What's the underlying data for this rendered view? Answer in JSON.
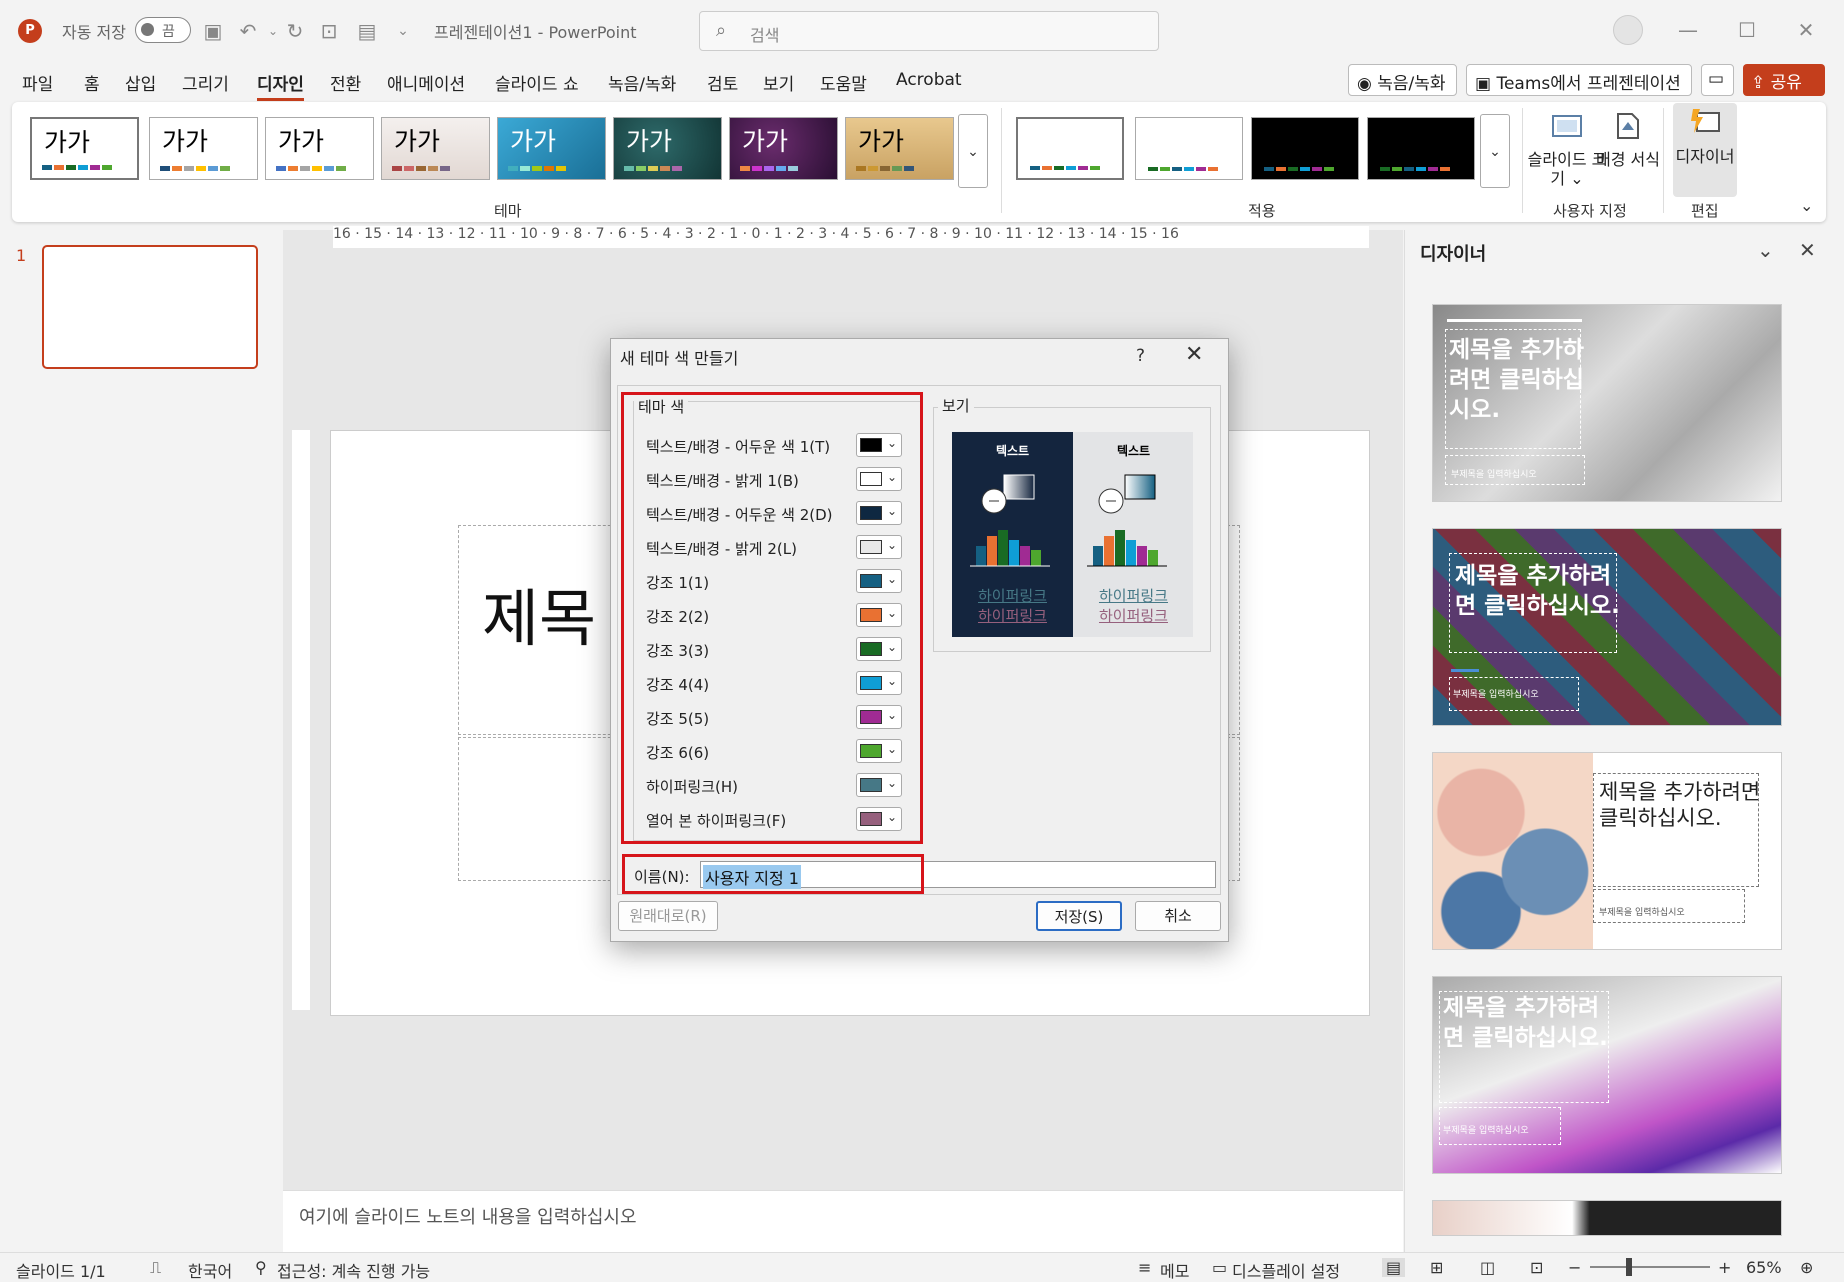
{
  "titlebar": {
    "autosave_label": "자동 저장",
    "autosave_state": "끔",
    "doc_title": "프레젠테이션1  -  PowerPoint",
    "search_placeholder": "검색"
  },
  "menu": {
    "items": [
      "파일",
      "홈",
      "삽입",
      "그리기",
      "디자인",
      "전환",
      "애니메이션",
      "슬라이드 쇼",
      "녹음/녹화",
      "검토",
      "보기",
      "도움말",
      "Acrobat"
    ],
    "active": "디자인",
    "record_btn": "녹음/녹화",
    "teams_btn": "Teams에서 프레젠테이션",
    "share_btn": "공유"
  },
  "ribbon": {
    "theme_sample": "가가",
    "themes_group": "테마",
    "variants_group": "적용",
    "slide_size_label": "슬라이드 크기",
    "background_label": "배경 서식",
    "custom_group": "사용자 지정",
    "designer_label": "디자이너",
    "edit_group": "편집"
  },
  "slides": {
    "number": "1"
  },
  "ruler_text": "16 · 15 · 14 · 13 · 12 · 11 · 10 · 9 · 8 · 7 · 6 · 5 · 4 · 3 · 2 · 1 · 0 · 1 · 2 · 3 · 4 · 5 · 6 · 7 · 8 · 9 · 10 · 11 · 12 · 13 · 14 · 15 · 16",
  "slide": {
    "title_partial": "제목"
  },
  "notes_placeholder": "여기에 슬라이드 노트의 내용을 입력하십시오",
  "designer_pane": {
    "title": "디자이너",
    "card_title": "제목을 추가하려면 클릭하십시오.",
    "card_subtitle": "부제목을 입력하십시오"
  },
  "dialog": {
    "title": "새 테마 색 만들기",
    "help": "?",
    "theme_colors_legend": "테마 색",
    "preview_legend": "보기",
    "colors": [
      {
        "label": "텍스트/배경 - 어두운 색 1(T)",
        "color": "#000000"
      },
      {
        "label": "텍스트/배경 - 밝게 1(B)",
        "color": "#ffffff"
      },
      {
        "label": "텍스트/배경 - 어두운 색 2(D)",
        "color": "#0e2841"
      },
      {
        "label": "텍스트/배경 - 밝게 2(L)",
        "color": "#e8e8e8"
      },
      {
        "label": "강조 1(1)",
        "color": "#156082"
      },
      {
        "label": "강조 2(2)",
        "color": "#e97132"
      },
      {
        "label": "강조 3(3)",
        "color": "#196b24"
      },
      {
        "label": "강조 4(4)",
        "color": "#0f9ed5"
      },
      {
        "label": "강조 5(5)",
        "color": "#a02b93"
      },
      {
        "label": "강조 6(6)",
        "color": "#4ea72e"
      },
      {
        "label": "하이퍼링크(H)",
        "color": "#467886"
      },
      {
        "label": "열어 본 하이퍼링크(F)",
        "color": "#96607d"
      }
    ],
    "preview_text": "텍스트",
    "preview_link": "하이퍼링크",
    "name_label": "이름(N):",
    "name_value": "사용자 지정 1",
    "reset_btn": "원래대로(R)",
    "save_btn": "저장(S)",
    "cancel_btn": "취소"
  },
  "status": {
    "slide_info": "슬라이드 1/1",
    "language": "한국어",
    "accessibility": "접근성: 계속 진행 가능",
    "notes_btn": "메모",
    "display_settings": "디스플레이 설정",
    "zoom": "65%"
  }
}
